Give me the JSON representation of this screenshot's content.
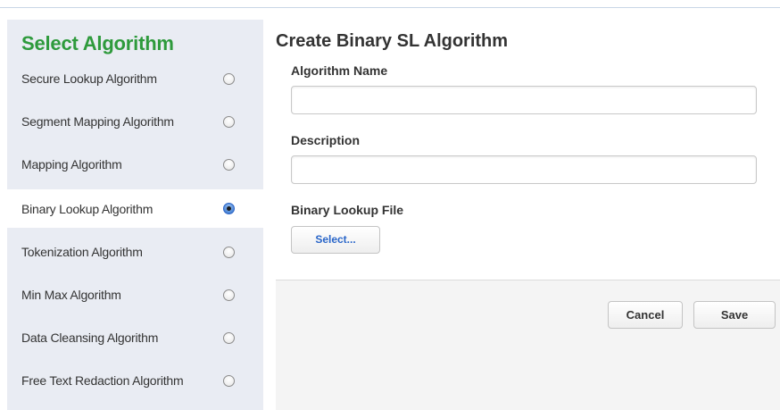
{
  "sidebar": {
    "title": "Select Algorithm",
    "items": [
      {
        "label": "Secure Lookup Algorithm",
        "selected": false
      },
      {
        "label": "Segment Mapping Algorithm",
        "selected": false
      },
      {
        "label": "Mapping Algorithm",
        "selected": false
      },
      {
        "label": "Binary Lookup Algorithm",
        "selected": true
      },
      {
        "label": "Tokenization Algorithm",
        "selected": false
      },
      {
        "label": "Min Max Algorithm",
        "selected": false
      },
      {
        "label": "Data Cleansing Algorithm",
        "selected": false
      },
      {
        "label": "Free Text Redaction Algorithm",
        "selected": false
      }
    ]
  },
  "form": {
    "title": "Create Binary SL Algorithm",
    "name_label": "Algorithm Name",
    "name_value": "",
    "description_label": "Description",
    "description_value": "",
    "file_label": "Binary Lookup File",
    "select_button": "Select..."
  },
  "footer": {
    "cancel_label": "Cancel",
    "save_label": "Save"
  }
}
